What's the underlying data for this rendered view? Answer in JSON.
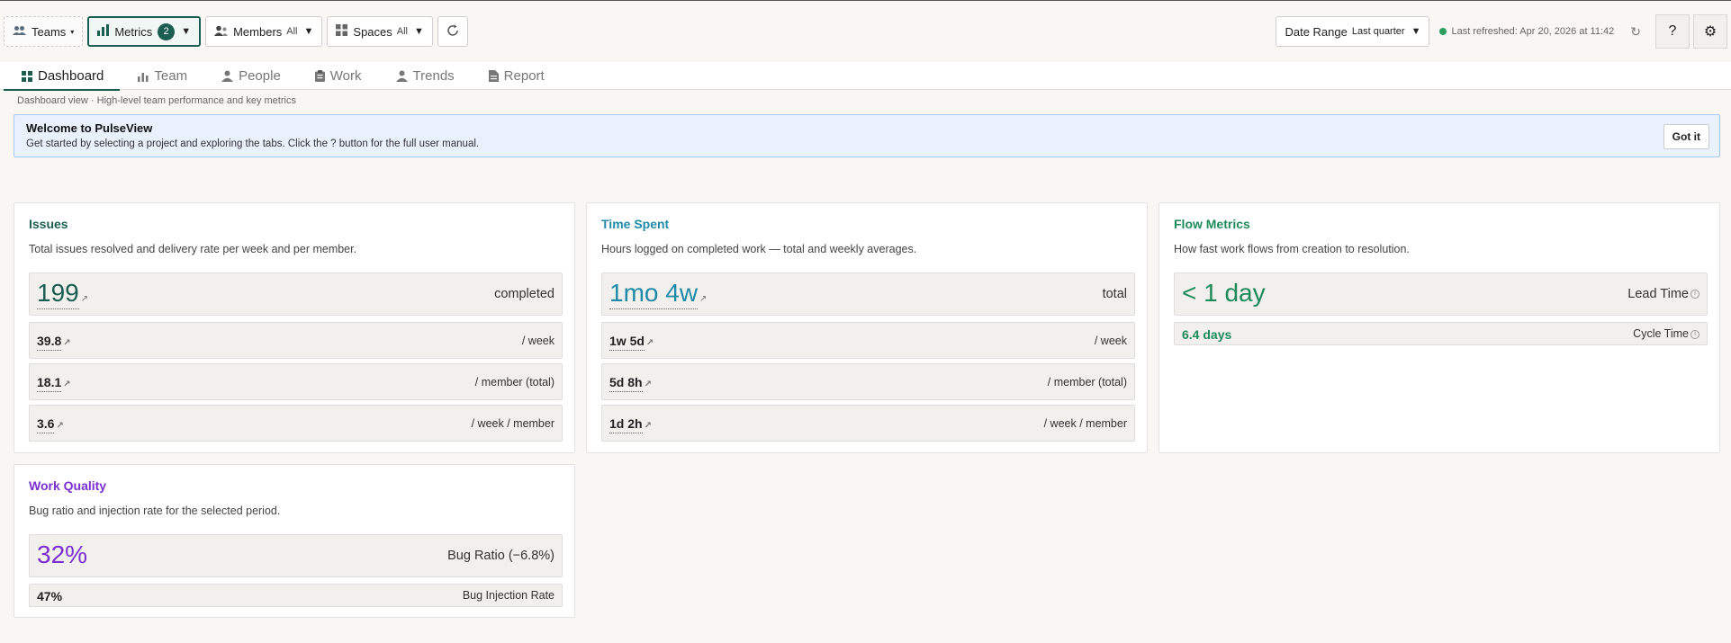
{
  "colors": {
    "accent": "#1b5e4f",
    "issues": "#1b5e4f",
    "time": "#1f8aa8",
    "flow": "#1e8a5a",
    "quality": "#7b2fd1",
    "status_ok": "#2e9e5e"
  },
  "toolbar": {
    "teams": {
      "label": "Teams",
      "icon": "people-icon"
    },
    "metrics": {
      "label": "Metrics",
      "count": "2",
      "icon": "bar-chart-icon"
    },
    "members": {
      "label": "Members",
      "value": "All",
      "icon": "members-icon"
    },
    "spaces": {
      "label": "Spaces",
      "value": "All",
      "icon": "grid-icon"
    },
    "date_range": {
      "label": "Date Range",
      "value": "Last quarter"
    },
    "last_refreshed": "Last refreshed: Apr 20, 2026 at 11:42",
    "help_label": "?"
  },
  "tabs": [
    {
      "label": "Dashboard",
      "icon": "dashboard-icon",
      "active": true
    },
    {
      "label": "Team",
      "icon": "bar-chart-icon"
    },
    {
      "label": "People",
      "icon": "person-icon"
    },
    {
      "label": "Work",
      "icon": "clipboard-icon"
    },
    {
      "label": "Trends",
      "icon": "person-icon"
    },
    {
      "label": "Report",
      "icon": "document-icon"
    }
  ],
  "subtitle": "Dashboard view · High-level team performance and key metrics",
  "banner": {
    "title": "Welcome to PulseView",
    "text": "Get started by selecting a project and exploring the tabs. Click the ? button for the full user manual.",
    "button": "Got it"
  },
  "cards": {
    "issues": {
      "title": "Issues",
      "description": "Total issues resolved and delivery rate per week and per member.",
      "metrics": [
        {
          "value": "199",
          "label": "completed"
        },
        {
          "value": "39.8",
          "label": "/ week"
        },
        {
          "value": "18.1",
          "label": "/ member (total)"
        },
        {
          "value": "3.6",
          "label": "/ week / member"
        }
      ]
    },
    "time": {
      "title": "Time Spent",
      "description": "Hours logged on completed work — total and weekly averages.",
      "metrics": [
        {
          "value": "1mo 4w",
          "label": "total"
        },
        {
          "value": "1w 5d",
          "label": "/ week"
        },
        {
          "value": "5d 8h",
          "label": "/ member (total)"
        },
        {
          "value": "1d 2h",
          "label": "/ week / member"
        }
      ]
    },
    "flow": {
      "title": "Flow Metrics",
      "description": "How fast work flows from creation to resolution.",
      "metrics": [
        {
          "value": "< 1 day",
          "label": "Lead Time"
        },
        {
          "value": "6.4 days",
          "label": "Cycle Time"
        }
      ]
    },
    "quality": {
      "title": "Work Quality",
      "description": "Bug ratio and injection rate for the selected period.",
      "metrics": [
        {
          "value": "32%",
          "label": "Bug Ratio (−6.8%)"
        },
        {
          "value": "47%",
          "label": "Bug Injection Rate"
        }
      ]
    }
  }
}
